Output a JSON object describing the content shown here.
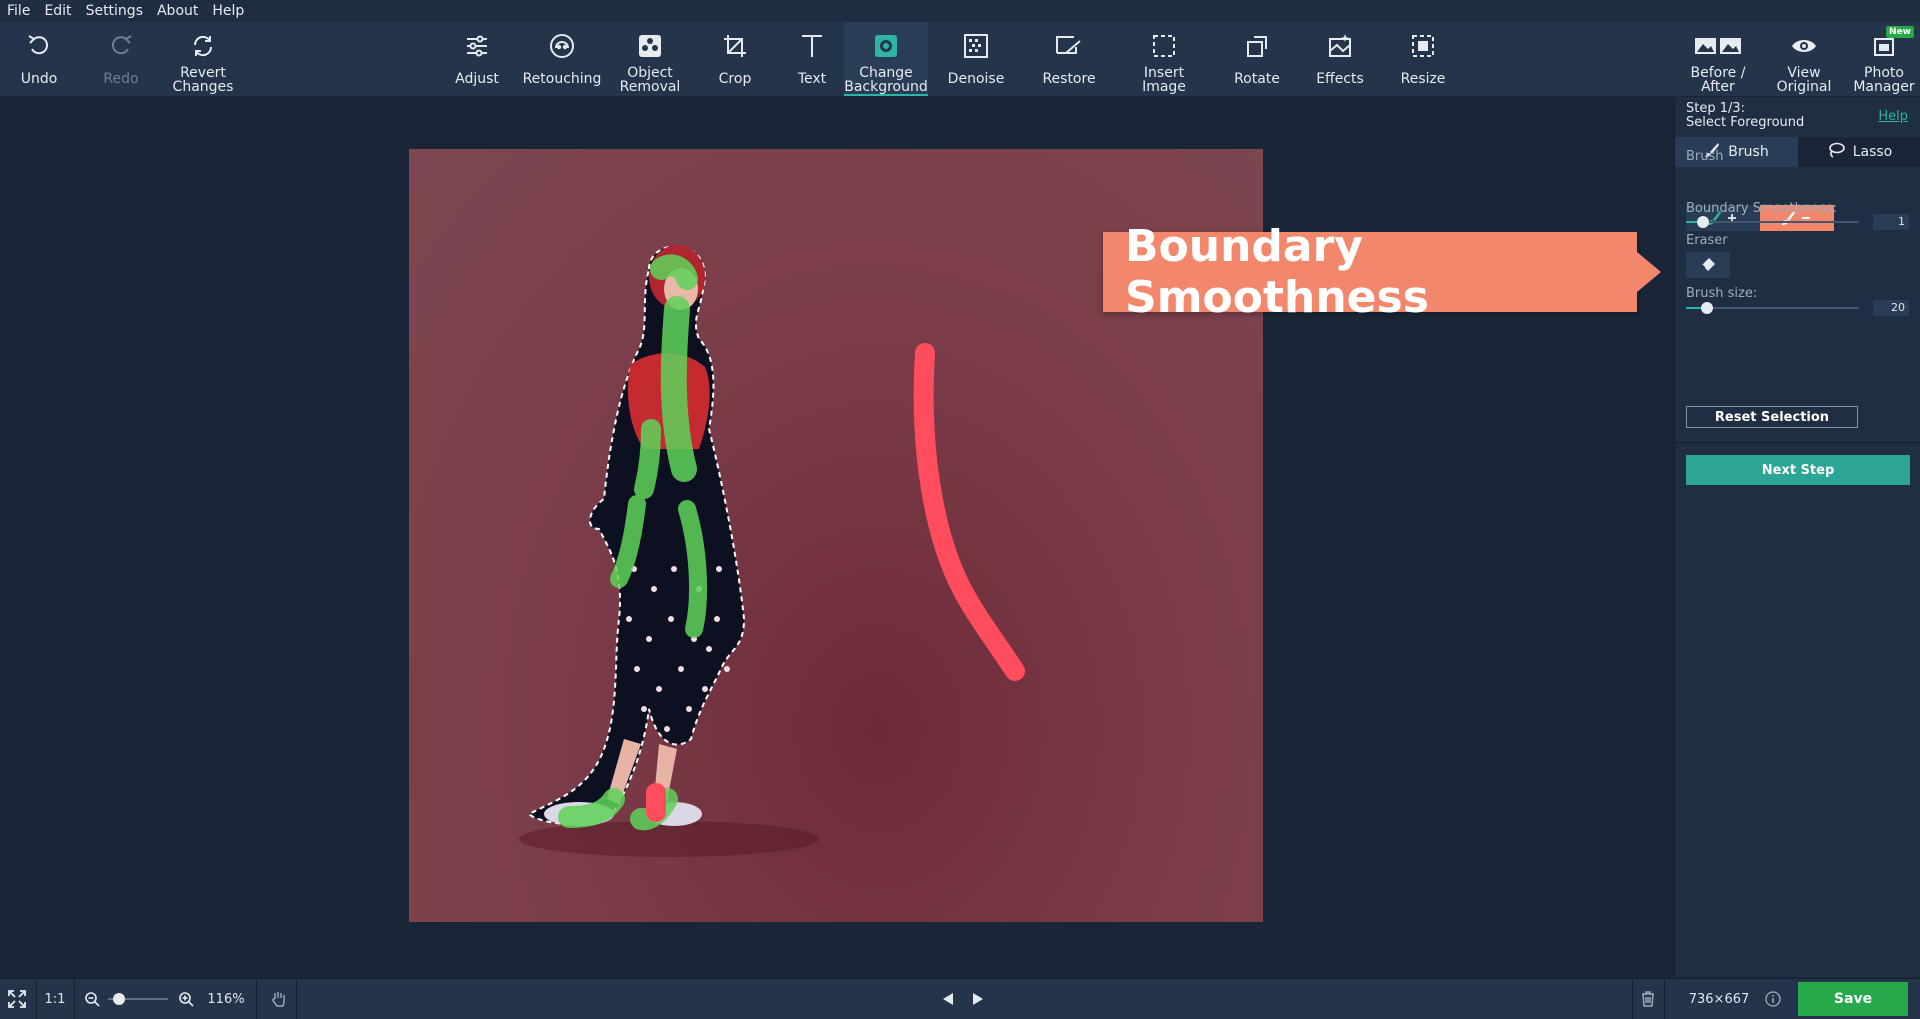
{
  "menu": [
    "File",
    "Edit",
    "Settings",
    "About",
    "Help"
  ],
  "toolbar": {
    "undo": "Undo",
    "redo": "Redo",
    "revert": "Revert\nChanges",
    "adjust": "Adjust",
    "retouching": "Retouching",
    "object_removal": "Object\nRemoval",
    "crop": "Crop",
    "text": "Text",
    "change_background": "Change\nBackground",
    "denoise": "Denoise",
    "restore": "Restore",
    "insert_image": "Insert\nImage",
    "rotate": "Rotate",
    "effects": "Effects",
    "resize": "Resize",
    "before_after": "Before /\nAfter",
    "view_original": "View\nOriginal",
    "photo_manager": "Photo\nManager",
    "new_badge": "New"
  },
  "callout": {
    "text": "Boundary Smoothness"
  },
  "panel": {
    "step_line1": "Step 1/3:",
    "step_line2": "Select Foreground",
    "help": "Help",
    "tab_brush": "Brush",
    "tab_lasso": "Lasso",
    "brush_label": "Brush",
    "smoothness_label": "Boundary Smoothness:",
    "smoothness_value": "1",
    "smoothness_level": 0.1,
    "eraser_label": "Eraser",
    "brush_size_label": "Brush size:",
    "brush_size_value": "20",
    "brush_size_level": 0.12,
    "reset_button": "Reset Selection",
    "next_button": "Next Step"
  },
  "bottom": {
    "one_to_one": "1:1",
    "zoom": "116%",
    "dimensions": "736×667",
    "save": "Save"
  },
  "colors": {
    "accent": "#2eb5a2",
    "remove_brush": "#f2876c",
    "save": "#27a94b",
    "foreground_mark": "#5fd35a",
    "background_mark": "#ff4d5e"
  }
}
